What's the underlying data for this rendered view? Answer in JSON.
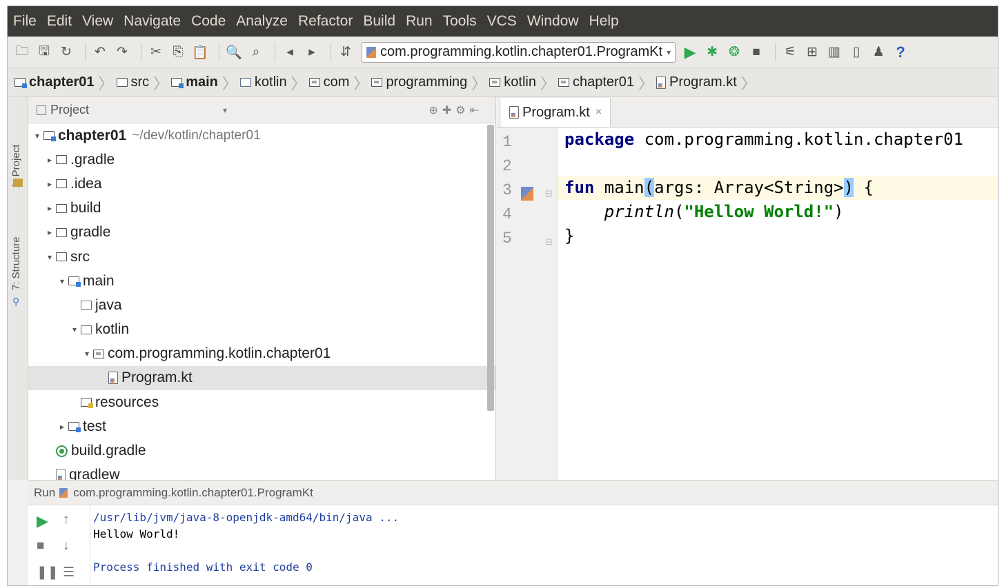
{
  "menu": {
    "items": [
      "File",
      "Edit",
      "View",
      "Navigate",
      "Code",
      "Analyze",
      "Refactor",
      "Build",
      "Run",
      "Tools",
      "VCS",
      "Window",
      "Help"
    ]
  },
  "toolbar": {
    "run_config": "com.programming.kotlin.chapter01.ProgramKt",
    "help_label": "?"
  },
  "breadcrumb": [
    "chapter01",
    "src",
    "main",
    "kotlin",
    "com",
    "programming",
    "kotlin",
    "chapter01",
    "Program.kt"
  ],
  "side_tabs": {
    "project": "1: Project",
    "structure": "7: Structure"
  },
  "project_panel": {
    "title": "Project",
    "tree": [
      {
        "label": "chapter01",
        "path": "~/dev/kotlin/chapter01"
      },
      {
        "label": ".gradle"
      },
      {
        "label": ".idea"
      },
      {
        "label": "build"
      },
      {
        "label": "gradle"
      },
      {
        "label": "src"
      },
      {
        "label": "main"
      },
      {
        "label": "java"
      },
      {
        "label": "kotlin"
      },
      {
        "label": "com.programming.kotlin.chapter01"
      },
      {
        "label": "Program.kt"
      },
      {
        "label": "resources"
      },
      {
        "label": "test"
      },
      {
        "label": "build.gradle"
      },
      {
        "label": "gradlew"
      }
    ]
  },
  "editor": {
    "tab_label": "Program.kt",
    "line_numbers": [
      "1",
      "2",
      "3",
      "4",
      "5"
    ],
    "code": {
      "l1_kw": "package",
      "l1_rest": " com.programming.kotlin.chapter01",
      "l3_kw": "fun",
      "l3_name": " main",
      "l3_open": "(",
      "l3_args": "args: Array<String>",
      "l3_close": ")",
      "l3_brace": " {",
      "l4_indent": "    ",
      "l4_fn": "println",
      "l4_open": "(",
      "l4_str": "\"Hellow World!\"",
      "l4_close": ")",
      "l5": "}"
    }
  },
  "run_panel": {
    "label": "Run",
    "config": "com.programming.kotlin.chapter01.ProgramKt",
    "console": {
      "cmd": "/usr/lib/jvm/java-8-openjdk-amd64/bin/java ...",
      "out": "Hellow World!",
      "exit": "Process finished with exit code 0"
    }
  },
  "colors": {
    "menubar": "#3c3b37",
    "keyword": "#000080",
    "string": "#008000",
    "run_green": "#2fa84f"
  }
}
